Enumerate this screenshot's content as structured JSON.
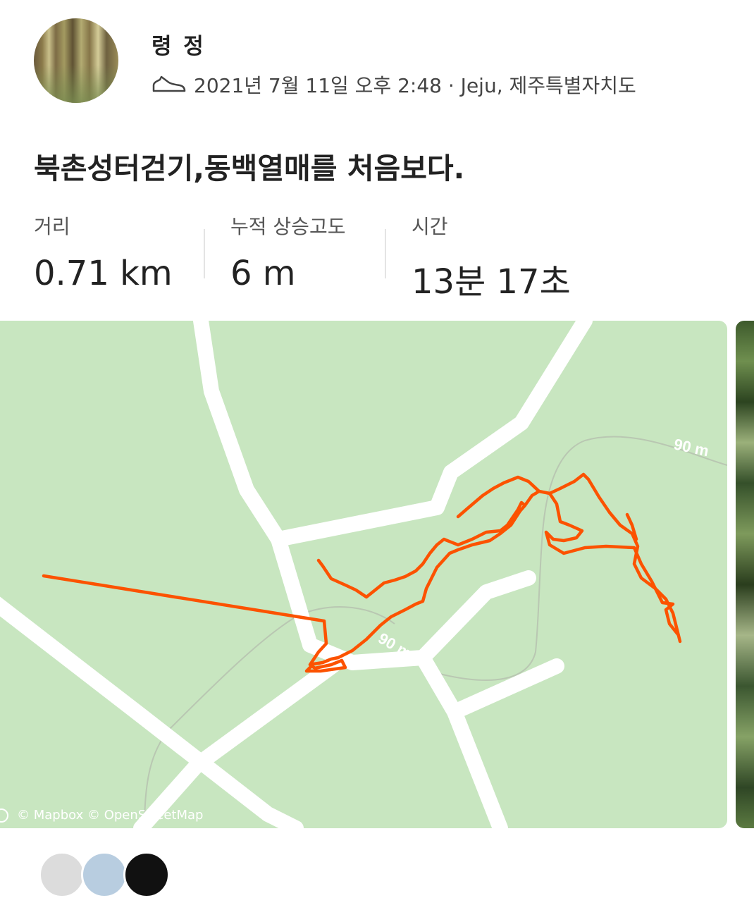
{
  "profile": {
    "name": "령 정",
    "activity_icon": "shoe-icon",
    "meta": "2021년 7월 11일 오후 2:48 · Jeju, 제주특별자치도"
  },
  "activity": {
    "title": "북촌성터걷기,동백열매를 처음보다."
  },
  "stats": [
    {
      "label": "거리",
      "value": "0.71 km"
    },
    {
      "label": "누적 상승고도",
      "value": "6 m"
    },
    {
      "label": "시간",
      "value": "13분 17초"
    }
  ],
  "map": {
    "contour_labels": [
      "90 m",
      "90 m"
    ],
    "attribution": "© Mapbox © OpenStreetMap",
    "route_color": "#fc5200",
    "land_color": "#c8e6c0"
  }
}
